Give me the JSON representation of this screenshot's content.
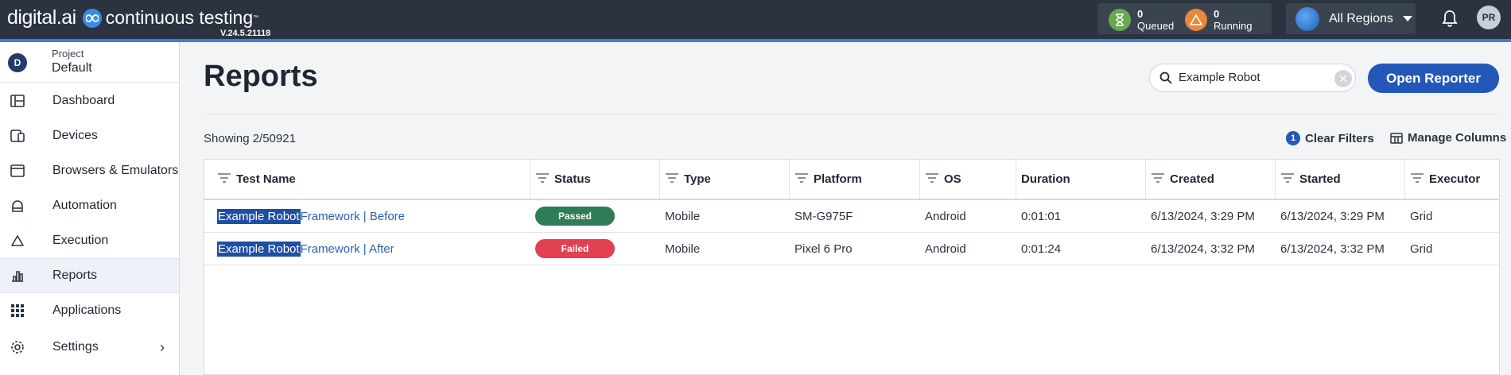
{
  "header": {
    "brand": "digital.ai",
    "product": "continuous testing",
    "trademark": "™",
    "version": "V.24.5.21118",
    "queued": {
      "count": "0",
      "label": "Queued"
    },
    "running": {
      "count": "0",
      "label": "Running"
    },
    "region": "All Regions",
    "user_initials": "PR"
  },
  "sidebar": {
    "project_label": "Project",
    "project_name": "Default",
    "project_initial": "D",
    "items": [
      {
        "label": "Dashboard",
        "icon": "dashboard-icon"
      },
      {
        "label": "Devices",
        "icon": "devices-icon"
      },
      {
        "label": "Browsers & Emulators",
        "icon": "browser-icon"
      },
      {
        "label": "Automation",
        "icon": "automation-icon"
      },
      {
        "label": "Execution",
        "icon": "execution-icon"
      },
      {
        "label": "Reports",
        "icon": "reports-icon",
        "active": true
      },
      {
        "label": "Applications",
        "icon": "applications-icon"
      },
      {
        "label": "Settings",
        "icon": "settings-icon"
      }
    ],
    "settings_chevron": "›"
  },
  "main": {
    "title": "Reports",
    "search_value": "Example Robot",
    "open_reporter": "Open Reporter",
    "showing": "Showing 2/50921",
    "filter_count": "1",
    "clear_filters": "Clear Filters",
    "manage_columns": "Manage Columns"
  },
  "table": {
    "columns": [
      "Test Name",
      "Status",
      "Type",
      "Platform",
      "OS",
      "Duration",
      "Created",
      "Started",
      "Executor"
    ],
    "rows": [
      {
        "name_match": "Example Robot",
        "name_rest": " Framework | Before",
        "status": "Passed",
        "type": "Mobile",
        "platform": "SM-G975F",
        "os": "Android",
        "duration": "0:01:01",
        "created": "6/13/2024, 3:29 PM",
        "started": "6/13/2024, 3:29 PM",
        "executor": "Grid"
      },
      {
        "name_match": "Example Robot",
        "name_rest": " Framework | After",
        "status": "Failed",
        "type": "Mobile",
        "platform": "Pixel 6 Pro",
        "os": "Android",
        "duration": "0:01:24",
        "created": "6/13/2024, 3:32 PM",
        "started": "6/13/2024, 3:32 PM",
        "executor": "Grid"
      }
    ]
  },
  "colors": {
    "header_bg": "#2b3341",
    "accent": "#3b7ddd",
    "primary_button": "#2358b8",
    "passed": "#2e7d57",
    "failed": "#e0404f",
    "queued_circle": "#6aa84f",
    "running_circle": "#e8883a"
  }
}
